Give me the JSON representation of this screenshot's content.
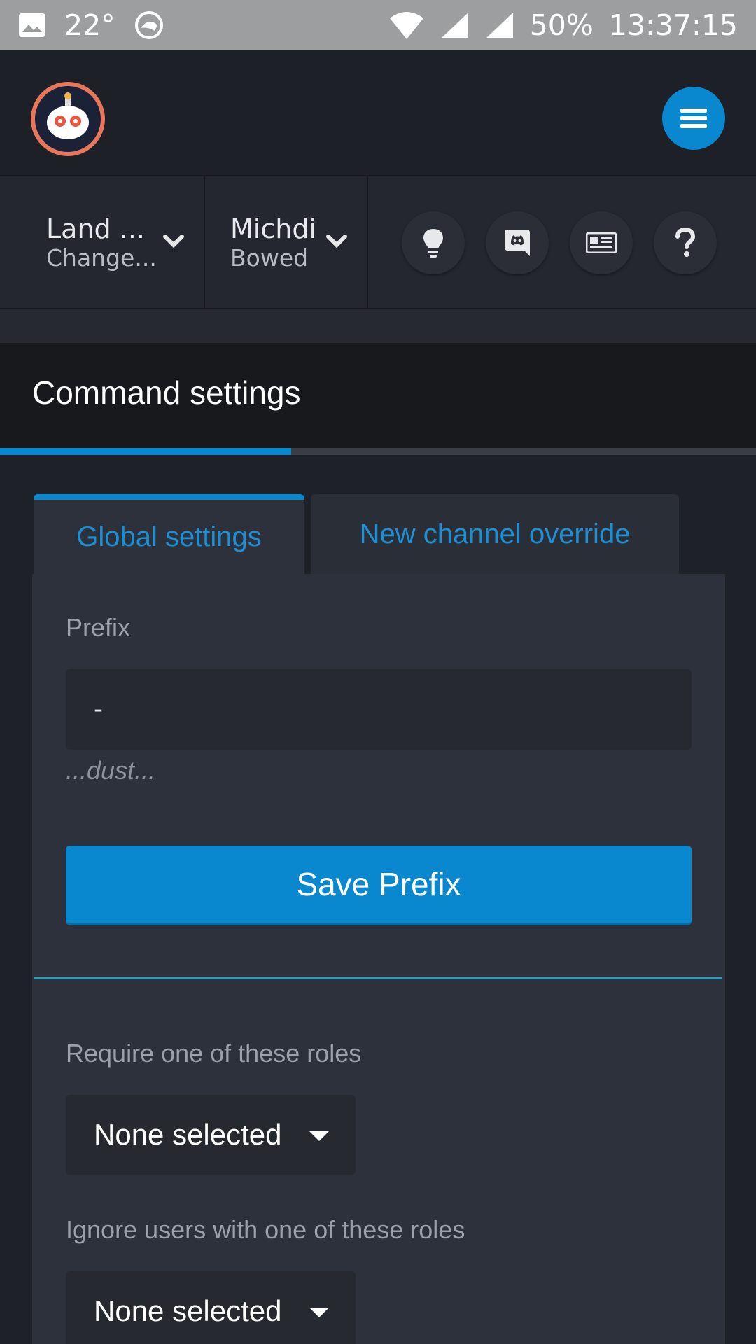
{
  "statusbar": {
    "temperature": "22°",
    "battery": "50%",
    "time": "13:37:15"
  },
  "header": {
    "menu_icon": "hamburger-icon"
  },
  "nav": {
    "server_name": "Land ...",
    "server_sub": "Change...",
    "user_name": "Michdi",
    "user_sub": "Bowed",
    "buttons": [
      "lightbulb-icon",
      "discord-icon",
      "news-icon",
      "help-icon"
    ]
  },
  "card": {
    "title": "Command settings",
    "progress_fraction": 0.385
  },
  "tabs": {
    "global": "Global settings",
    "override": "New channel override"
  },
  "form": {
    "prefix_label": "Prefix",
    "prefix_value": "-",
    "prefix_hint": "...dust...",
    "save_label": "Save Prefix",
    "require_label": "Require one of these roles",
    "require_value": "None selected",
    "ignore_label": "Ignore users with one of these roles",
    "ignore_value": "None selected"
  },
  "colors": {
    "accent": "#0a88cf",
    "background": "#1f2129",
    "panel": "#2d313b"
  }
}
